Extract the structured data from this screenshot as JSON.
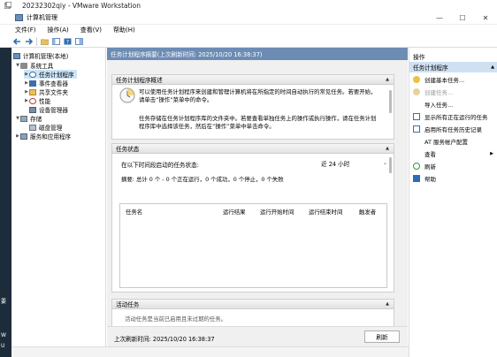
{
  "vmware": {
    "title": "20232302qiy - VMware Workstation"
  },
  "window": {
    "title": "计算机管理",
    "controls": [
      "—",
      "☐",
      "✕"
    ]
  },
  "menu": [
    "文件(F)",
    "操作(A)",
    "查看(V)",
    "帮助(H)"
  ],
  "desk_labels": [
    "要",
    "W",
    "U"
  ],
  "tree": {
    "root": "计算机管理(本地)",
    "items": [
      "系统工具",
      "任务计划程序",
      "事件查看器",
      "共享文件夹",
      "性能",
      "设备管理器",
      "存储",
      "磁盘管理",
      "服务和应用程序"
    ]
  },
  "center": {
    "header": "任务计划程序摘要(上次刷新时间: 2025/10/20 16:38:37)",
    "overview": {
      "title": "任务计划程序概述",
      "p1": "可以使用任务计划程序来创建和管理计算机将在所指定的时间自动执行的常见任务。若要开始，请单击“操作”菜单中的命令。",
      "p2": "任务存储在任务计划程序库的文件夹中。若要查看单独任务上的操作或执行操作，请在任务计划程序库中选择该任务，然后在“操作”菜单中单击命令。"
    },
    "status": {
      "title": "任务状态",
      "label": "在以下时间段启动的任务状态:",
      "period": "近 24 小时",
      "summary": "摘要: 总计 0 个 - 0 个正在运行，0 个成功，0 个停止，0 个失败",
      "columns": [
        "任务名",
        "运行结果",
        "运行开始时间",
        "运行结束时间",
        "触发者"
      ]
    },
    "active": {
      "title": "活动任务",
      "cut_text": "活动任务是当前已启用且未过期的任务。"
    },
    "footer": {
      "last_refresh": "上次刷新时间: 2025/10/20 16:38:37",
      "refresh_button": "刷新"
    }
  },
  "actions": {
    "title": "操作",
    "section": "任务计划程序",
    "items": [
      {
        "label": "创建基本任务...",
        "disabled": false
      },
      {
        "label": "创建任务...",
        "disabled": true
      },
      {
        "label": "导入任务...",
        "disabled": false
      },
      {
        "label": "显示所有正在运行的任务",
        "disabled": false
      },
      {
        "label": "启用所有任务历史记录",
        "disabled": false
      },
      {
        "label": "AT 服务帐户配置",
        "disabled": false
      },
      {
        "label": "查看",
        "disabled": false
      },
      {
        "label": "刷新",
        "disabled": false
      },
      {
        "label": "帮助",
        "disabled": false
      }
    ]
  }
}
